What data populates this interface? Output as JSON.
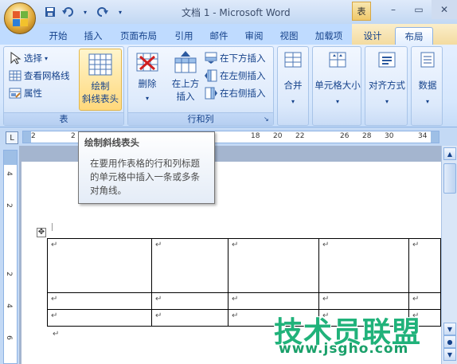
{
  "window": {
    "title": "文档 1 - Microsoft Word",
    "context_tab_group": "表",
    "minimize": "–",
    "maximize": "▭",
    "close": "✕"
  },
  "tabs": [
    {
      "label": "开始"
    },
    {
      "label": "插入"
    },
    {
      "label": "页面布局"
    },
    {
      "label": "引用"
    },
    {
      "label": "邮件"
    },
    {
      "label": "审阅"
    },
    {
      "label": "视图"
    },
    {
      "label": "加载项"
    },
    {
      "label": "设计"
    },
    {
      "label": "布局"
    }
  ],
  "ribbon": {
    "table_group": {
      "label": "表",
      "select": "选择",
      "view_gridlines": "查看网格线",
      "properties": "属性",
      "draw_diagonal_line1": "绘制",
      "draw_diagonal_line2": "斜线表头"
    },
    "rows_cols_group": {
      "label": "行和列",
      "delete": "删除",
      "insert_above1": "在上方",
      "insert_above2": "插入",
      "insert_below": "在下方插入",
      "insert_left": "在左侧插入",
      "insert_right": "在右侧插入"
    },
    "merge": "合并",
    "cell_size": "单元格大小",
    "alignment": "对齐方式",
    "data": "数据"
  },
  "ruler": {
    "tab_selector": "L",
    "numbers": [
      "2",
      "2",
      "18",
      "20",
      "22",
      "26",
      "28",
      "30",
      "34"
    ],
    "vnumbers": [
      "4",
      "2",
      "2",
      "4",
      "6"
    ]
  },
  "tooltip": {
    "title": "绘制斜线表头",
    "body": [
      "在要用作表格的行和列标题",
      "的单元格中插入一条或多条",
      "对角线。"
    ]
  },
  "document": {
    "para_mark": "↵",
    "move_handle": "✥"
  },
  "watermark": {
    "main": "技术员联盟",
    "url": "www.jsgho.com"
  },
  "colors": {
    "ribbon_text": "#15428b",
    "watermark": "#20b27a",
    "highlight": "#ffd87b"
  }
}
